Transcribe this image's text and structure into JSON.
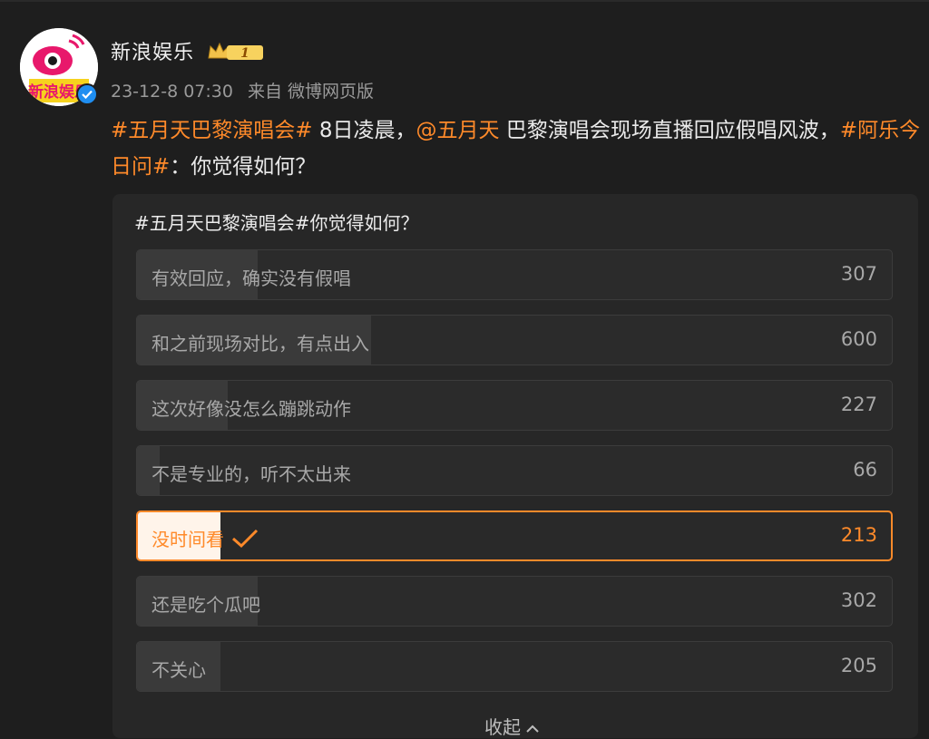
{
  "post": {
    "author": "新浪娱乐",
    "level_badge": "1",
    "time": "23-12-8 07:30",
    "source": "来自 微博网页版",
    "text": {
      "tag1": "#五月天巴黎演唱会#",
      "part1": " 8日凌晨，",
      "mention": "@五月天",
      "part2": " 巴黎演唱会现场直播回应假唱风波，",
      "tag2": "#阿乐今日问#",
      "part3": "：你觉得如何？"
    },
    "avatar_text": "新浪娱乐"
  },
  "poll": {
    "title": "#五月天巴黎演唱会#你觉得如何？",
    "options": [
      {
        "label": "有效回应，确实没有假唱",
        "count": "307",
        "share": 0.16
      },
      {
        "label": "和之前现场对比，有点出入",
        "count": "600",
        "share": 0.31
      },
      {
        "label": "这次好像没怎么蹦跳动作",
        "count": "227",
        "share": 0.12
      },
      {
        "label": "不是专业的，听不太出来",
        "count": "66",
        "share": 0.03
      },
      {
        "label": "没时间看",
        "count": "213",
        "share": 0.11,
        "selected": true
      },
      {
        "label": "还是吃个瓜吧",
        "count": "302",
        "share": 0.16
      },
      {
        "label": "不关心",
        "count": "205",
        "share": 0.11
      }
    ],
    "collapse_label": "收起"
  },
  "colors": {
    "accent": "#ff8a2a",
    "background": "#1e1e1e",
    "card": "#272727",
    "verified": "#1f8ef1"
  },
  "icons": [
    "verified-icon",
    "level-crown-icon",
    "checkmark-icon",
    "chevron-up-icon"
  ]
}
